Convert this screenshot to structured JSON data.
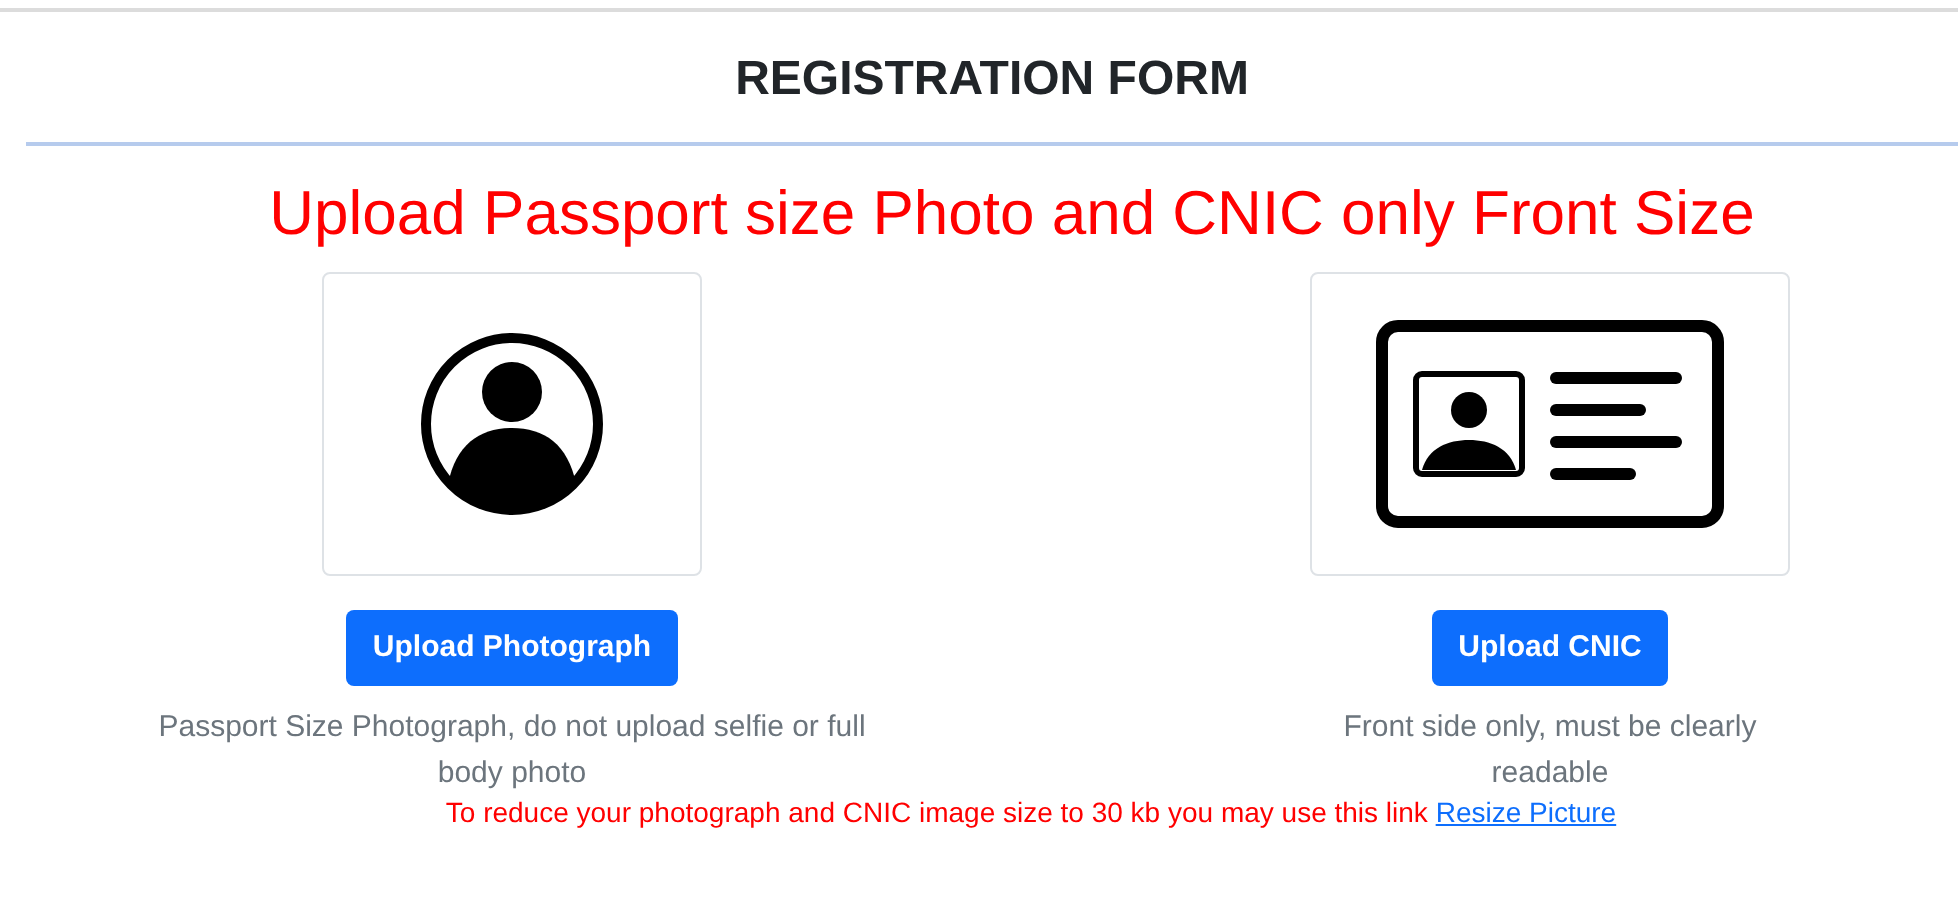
{
  "header": {
    "title": "REGISTRATION FORM"
  },
  "heading": "Upload Passport size Photo and CNIC only Front Size",
  "uploaders": [
    {
      "kind": "photo",
      "button": "Upload Photograph",
      "hint": "Passport Size Photograph, do not upload selfie or full body photo"
    },
    {
      "kind": "id-card",
      "button": "Upload CNIC",
      "hint": "Front side only, must be clearly readable"
    }
  ],
  "note": {
    "text": "To reduce your photograph and CNIC image size to 30 kb you may use this link",
    "link": "Resize Picture"
  }
}
